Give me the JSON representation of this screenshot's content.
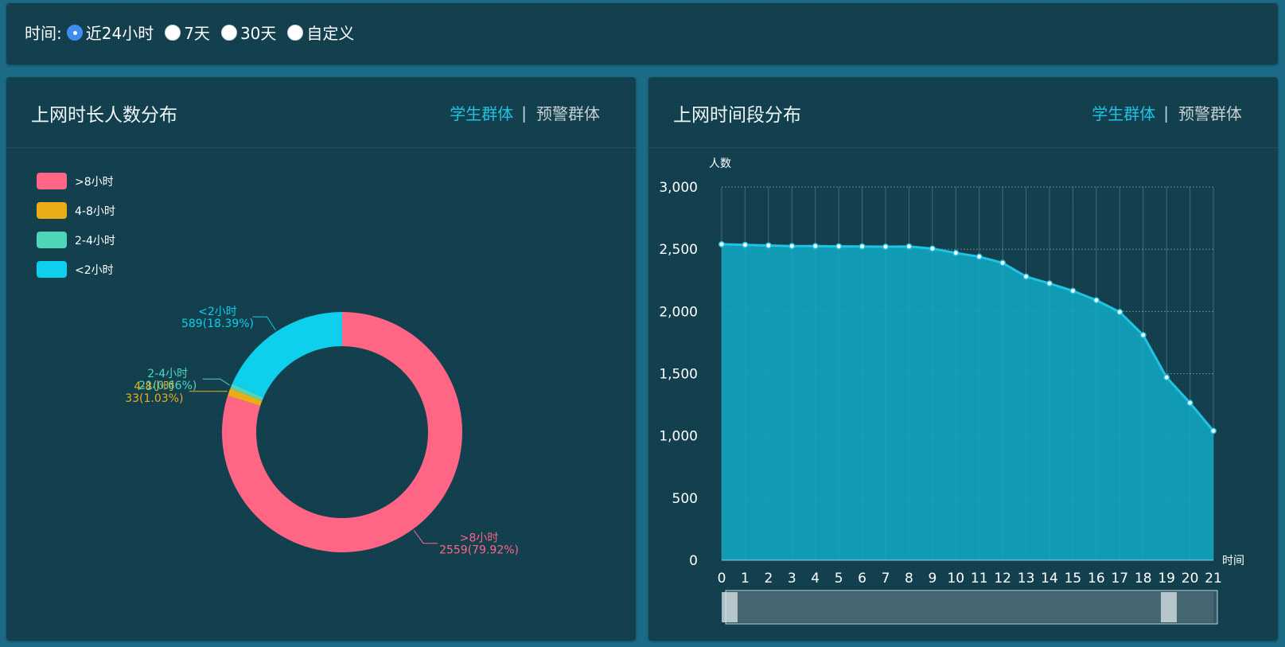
{
  "filter": {
    "label": "时间:",
    "options": [
      {
        "label": "近24小时",
        "checked": true
      },
      {
        "label": "7天",
        "checked": false
      },
      {
        "label": "30天",
        "checked": false
      },
      {
        "label": "自定义",
        "checked": false
      }
    ]
  },
  "left_panel": {
    "title": "上网时长人数分布",
    "tab_active": "学生群体",
    "tab_separator": "|",
    "tab_inactive": "预警群体"
  },
  "right_panel": {
    "title": "上网时间段分布",
    "tab_active": "学生群体",
    "tab_separator": "|",
    "tab_inactive": "预警群体"
  },
  "colors": {
    "accent": "#1fc3e3",
    "gt8": "#ff6584",
    "h4_8": "#e9ad19",
    "h2_4": "#4fd6b8",
    "lt2": "#0ecfec",
    "area_fill": "#11a7c3",
    "line": "#1fc3e3"
  },
  "chart_data": [
    {
      "type": "pie",
      "donut": true,
      "legend_position": "top-left",
      "legend": [
        ">8小时",
        "4-8小时",
        "2-4小时",
        "<2小时"
      ],
      "slices": [
        {
          "name": ">8小时",
          "value": 2559,
          "percent": "79.92%",
          "label_name": ">8小时",
          "label_value": "2559(79.92%)",
          "color": "#ff6584"
        },
        {
          "name": "4-8小时",
          "value": 33,
          "percent": "1.03%",
          "label_name": "4-8小时",
          "label_value": "33(1.03%)",
          "color": "#e9ad19"
        },
        {
          "name": "2-4小时",
          "value": 21,
          "percent": "0.66%",
          "label_name": "2-4小时",
          "label_value": "21(0.66%)",
          "color": "#4fd6b8"
        },
        {
          "name": "<2小时",
          "value": 589,
          "percent": "18.39%",
          "label_name": "<2小时",
          "label_value": "589(18.39%)",
          "color": "#0ecfec"
        }
      ]
    },
    {
      "type": "area",
      "xlabel": "时间",
      "ylabel": "人数",
      "ylim": [
        0,
        3000
      ],
      "yticks": [
        "0",
        "500",
        "1,000",
        "1,500",
        "2,000",
        "2,500",
        "3,000"
      ],
      "ytick_values": [
        0,
        500,
        1000,
        1500,
        2000,
        2500,
        3000
      ],
      "categories": [
        "0",
        "1",
        "2",
        "3",
        "4",
        "5",
        "6",
        "7",
        "8",
        "9",
        "10",
        "11",
        "12",
        "13",
        "14",
        "15",
        "16",
        "17",
        "18",
        "19",
        "20",
        "21"
      ],
      "values": [
        2540,
        2535,
        2530,
        2525,
        2525,
        2523,
        2522,
        2520,
        2522,
        2505,
        2470,
        2440,
        2390,
        2280,
        2225,
        2165,
        2090,
        1995,
        1810,
        1470,
        1265,
        1040
      ],
      "grid": true,
      "data_zoom": [
        0,
        21
      ]
    }
  ]
}
